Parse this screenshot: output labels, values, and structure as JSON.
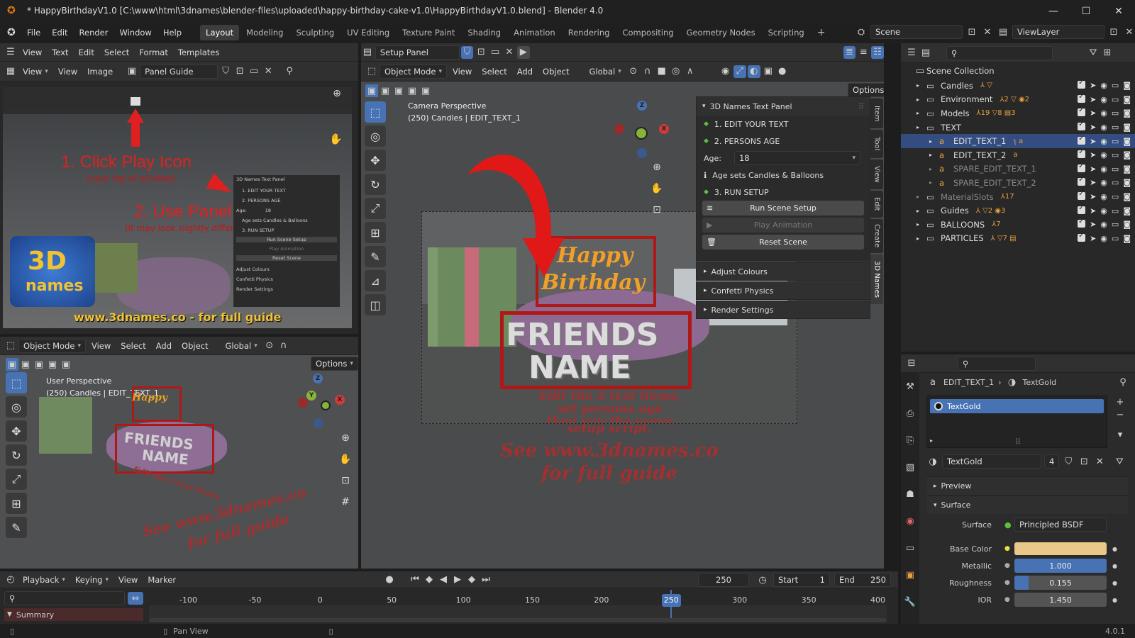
{
  "titlebar": {
    "title": "* HappyBirthdayV1.0 [C:\\www\\html\\3dnames\\blender-files\\uploaded\\happy-birthday-cake-v1.0\\HappyBirthdayV1.0.blend] - Blender 4.0",
    "min": "—",
    "max": "☐",
    "close": "✕"
  },
  "menu": {
    "items": [
      "File",
      "Edit",
      "Render",
      "Window",
      "Help"
    ],
    "tabs": [
      "Layout",
      "Modeling",
      "Sculpting",
      "UV Editing",
      "Texture Paint",
      "Shading",
      "Animation",
      "Rendering",
      "Compositing",
      "Geometry Nodes",
      "Scripting"
    ],
    "scene": "Scene",
    "viewlayer": "ViewLayer"
  },
  "text_editor": {
    "menus": [
      "View",
      "Text",
      "Edit",
      "Select",
      "Format",
      "Templates"
    ],
    "file": "Setup Panel"
  },
  "image_editor": {
    "menus": [
      "View",
      "View",
      "Image"
    ],
    "image": "Panel Guide",
    "guide": {
      "step1": "1. Click Play Icon",
      "step1_sub": "(near top of window)",
      "step2": "2. Use Panel",
      "step2_sub": "(it may look slightly different)",
      "logo_top": "3D",
      "logo_bottom": "names",
      "url": "www.3dnames.co - for full guide",
      "mini_panel": [
        "3D Names Text Panel",
        "1. EDIT YOUR TEXT",
        "2. PERSONS AGE",
        "Age:",
        "18",
        "Age sets Candles & Balloons",
        "3. RUN SETUP",
        "Run Scene Setup",
        "Play Animation",
        "Reset Scene",
        "Adjust Colours",
        "Confetti Physics",
        "Render Settings"
      ]
    }
  },
  "viewport_main": {
    "mode": "Object Mode",
    "menus": [
      "View",
      "Select",
      "Add",
      "Object"
    ],
    "orientation": "Global",
    "options": "Options",
    "info_line1": "Camera Perspective",
    "info_line2": "(250) Candles | EDIT_TEXT_1",
    "scene_text": {
      "happy": "Happy",
      "birthday": "Birthday",
      "name1": "FRIENDS",
      "name2": "NAME",
      "edit1": "Edit the 2 text items,",
      "edit2": "set persons age",
      "edit3": "then run the scene",
      "edit4": "setup script.",
      "see1": "See www.3dnames.co",
      "see2": "for full guide"
    },
    "panel": {
      "title": "3D Names Text Panel",
      "step1": "1. EDIT YOUR TEXT",
      "step2": "2. PERSONS AGE",
      "age_label": "Age:",
      "age_value": "18",
      "age_note": "Age sets Candles & Balloons",
      "step3": "3. RUN SETUP",
      "run": "Run Scene Setup",
      "play": "Play Animation",
      "reset": "Reset Scene",
      "adjust": "Adjust Colours",
      "confetti": "Confetti Physics",
      "render": "Render Settings"
    },
    "sidetabs": [
      "Item",
      "Tool",
      "View",
      "Edit",
      "Create",
      "3D Names"
    ],
    "gizmo": {
      "x": "X",
      "y": "Y",
      "z": "Z"
    }
  },
  "viewport_small": {
    "mode": "Object Mode",
    "menus": [
      "View",
      "Select",
      "Add",
      "Object"
    ],
    "orientation": "Global",
    "options": "Options",
    "info_line1": "User Perspective",
    "info_line2": "(250) Candles | EDIT_TEXT_1"
  },
  "outliner": {
    "root": "Scene Collection",
    "rows": [
      {
        "name": "Candles",
        "sel": false,
        "indent": 0,
        "badges": "⅄ ▽"
      },
      {
        "name": "Environment",
        "sel": false,
        "indent": 0,
        "badges": "⅄2 ▽ ◉2"
      },
      {
        "name": "Models",
        "sel": false,
        "indent": 0,
        "badges": "⅄19 ▽8 ▤3"
      },
      {
        "name": "TEXT",
        "sel": false,
        "indent": 0,
        "badges": ""
      },
      {
        "name": "EDIT_TEXT_1",
        "sel": true,
        "indent": 1,
        "badges": "ʅ a"
      },
      {
        "name": "EDIT_TEXT_2",
        "sel": false,
        "indent": 1,
        "badges": "a"
      },
      {
        "name": "SPARE_EDIT_TEXT_1",
        "sel": false,
        "indent": 1,
        "badges": "",
        "dim": true
      },
      {
        "name": "SPARE_EDIT_TEXT_2",
        "sel": false,
        "indent": 1,
        "badges": "",
        "dim": true
      },
      {
        "name": "MaterialSlots",
        "sel": false,
        "indent": 0,
        "badges": "⅄17",
        "dim": true
      },
      {
        "name": "Guides",
        "sel": false,
        "indent": 0,
        "badges": "⅄ ▽2 ◉3"
      },
      {
        "name": "BALLOONS",
        "sel": false,
        "indent": 0,
        "badges": "⅄7"
      },
      {
        "name": "PARTICLES",
        "sel": false,
        "indent": 0,
        "badges": "⅄ ▽7 ▤"
      }
    ]
  },
  "properties": {
    "crumb_obj": "EDIT_TEXT_1",
    "crumb_mat": "TextGold",
    "slot": "TextGold",
    "material": "TextGold",
    "users": "4",
    "preview": "Preview",
    "surface_header": "Surface",
    "props": [
      {
        "label": "Surface",
        "value": "Principled BSDF"
      },
      {
        "label": "Base Color",
        "value": ""
      },
      {
        "label": "Metallic",
        "value": "1.000"
      },
      {
        "label": "Roughness",
        "value": "0.155"
      },
      {
        "label": "IOR",
        "value": "1.450"
      }
    ],
    "base_color": "#e8c98a",
    "metallic": 1.0,
    "roughness": 0.155
  },
  "timeline": {
    "menus": [
      "Playback",
      "Keying",
      "View",
      "Marker"
    ],
    "frame": "250",
    "start_label": "Start",
    "start": "1",
    "end_label": "End",
    "end": "250",
    "ticks": [
      "-100",
      "-50",
      "0",
      "50",
      "100",
      "150",
      "200",
      "250",
      "300",
      "350",
      "400"
    ],
    "summary": "Summary"
  },
  "statusbar": {
    "hint": "Pan View",
    "version": "4.0.1"
  },
  "colors": {
    "accent": "#4772b3",
    "selected_row": "#334d80"
  }
}
